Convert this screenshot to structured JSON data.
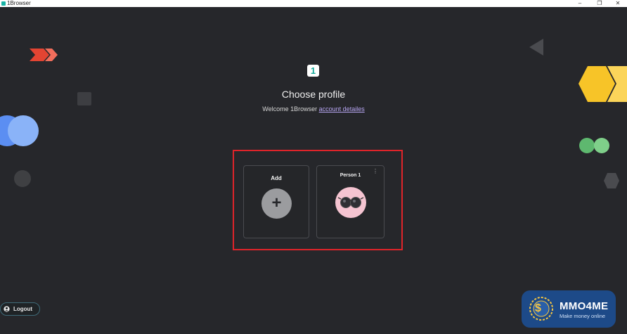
{
  "window": {
    "title": "1Browser",
    "controls": {
      "minimize": "–",
      "restore": "❐",
      "close": "✕"
    }
  },
  "logo": {
    "text": "1",
    "color": "#15a99a"
  },
  "heading": "Choose profile",
  "welcome": {
    "prefix": "Welcome 1Browser ",
    "link": "account detailes"
  },
  "profiles": {
    "add": {
      "label": "Add",
      "icon": "plus-icon"
    },
    "person": {
      "label": "Person 1",
      "menu_icon": "⋮",
      "avatar": "sunglasses-avatar-icon"
    }
  },
  "logout": {
    "label": "Logout",
    "icon": "user-icon"
  },
  "watermark": {
    "brand": "MMO4ME",
    "tagline": "Make money online",
    "coin_symbol": "$"
  },
  "colors": {
    "background": "#26272b",
    "highlight": "#e0242a",
    "accent_link": "#b7a6f2"
  }
}
